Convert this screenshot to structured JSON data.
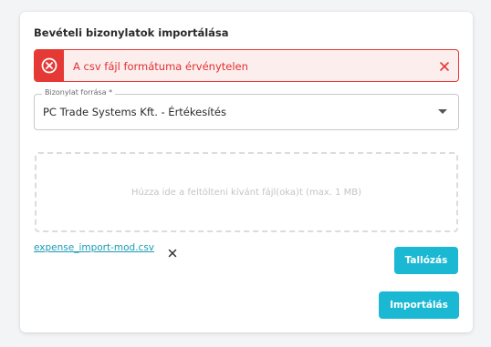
{
  "dialog": {
    "title": "Bevételi bizonylatok importálása"
  },
  "alert": {
    "message": "A csv fájl formátuma érvénytelen",
    "icon": "error-circle-x-icon",
    "close_icon": "close-icon",
    "color": "#e53935"
  },
  "source_select": {
    "label": "Bizonylat forrása *",
    "value": "PC Trade Systems Kft. - Értékesítés"
  },
  "dropzone": {
    "text": "Húzza ide a feltölteni kívánt fájl(oka)t (max. 1 MB)"
  },
  "file": {
    "name": "expense_import-mod.csv",
    "remove_icon": "close-icon"
  },
  "buttons": {
    "browse_label": "Tallózás",
    "import_label": "Importálás",
    "accent_color": "#1bb8d3"
  }
}
